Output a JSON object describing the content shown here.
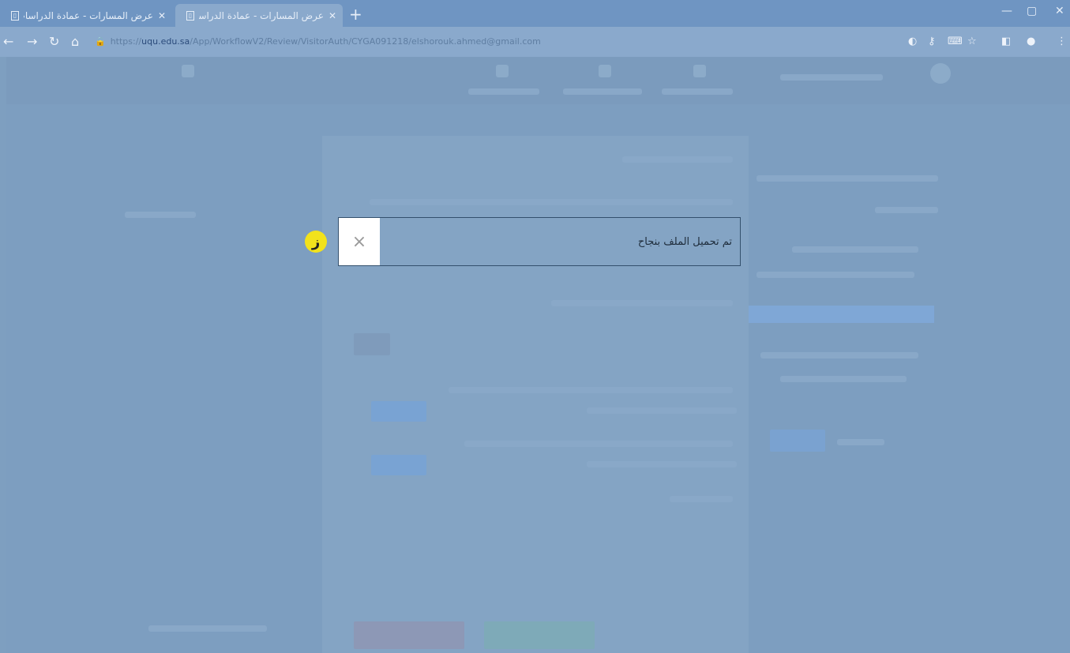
{
  "browser": {
    "tabs": [
      {
        "title": "عرض المسارات - عمادة الدراسات"
      },
      {
        "title": "عرض المسارات - عمادة الدراسات"
      }
    ],
    "url_scheme": "https://",
    "url_host": "uqu.edu.sa",
    "url_path": "/App/WorkflowV2/Review/VisitorAuth/CYGA091218/elshorouk.ahmed@gmail.com"
  },
  "toast": {
    "message": "تم تحميل الملف بنجاح",
    "close_symbol": "×"
  },
  "annotation": {
    "marker_label": "ز",
    "marker_color": "#f2e21c"
  }
}
